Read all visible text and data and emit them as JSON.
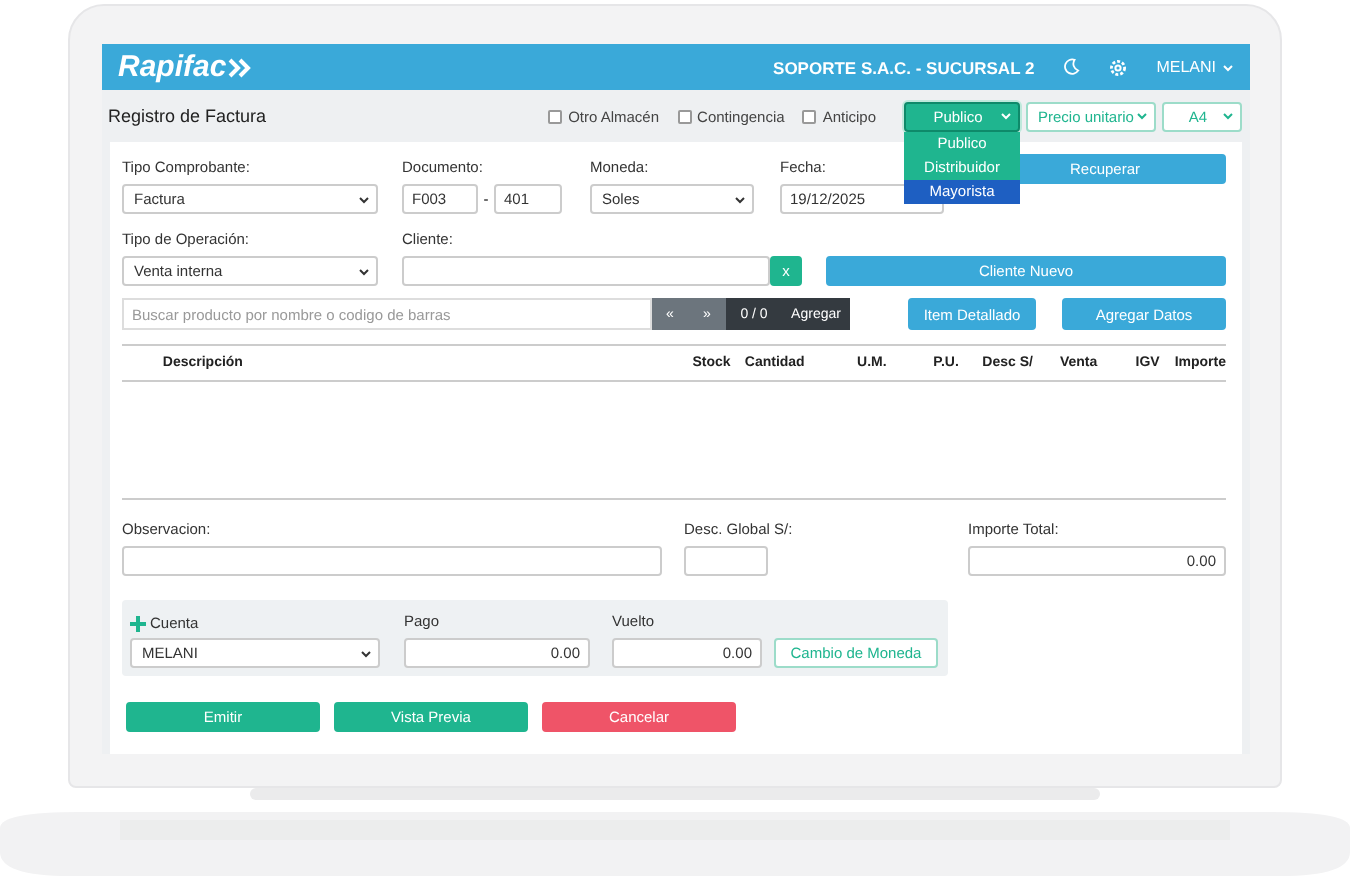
{
  "app": {
    "logo": "Rapifac",
    "company": "SOPORTE S.A.C. - SUCURSAL 2",
    "user": "MELANI"
  },
  "page_title": "Registro de Factura",
  "options": [
    {
      "label": "Otro Almacén",
      "checked": false
    },
    {
      "label": "Contingencia",
      "checked": false
    },
    {
      "label": "Anticipo",
      "checked": false
    }
  ],
  "price_list": {
    "value": "Publico",
    "expanded": true,
    "options": [
      {
        "label": "Publico",
        "highlighted": false
      },
      {
        "label": "Distribuidor",
        "highlighted": false
      },
      {
        "label": "Mayorista",
        "highlighted": true
      }
    ]
  },
  "price_type": "Precio unitario",
  "format": "A4",
  "tipo_comprobante": {
    "label": "Tipo Comprobante:",
    "value": "Factura"
  },
  "documento": {
    "label": "Documento:",
    "serie": "F003",
    "separator": "-",
    "numero": "401"
  },
  "moneda": {
    "label": "Moneda:",
    "value": "Soles"
  },
  "fecha": {
    "label": "Fecha:",
    "value": "19/12/2025"
  },
  "recuperar": "Recuperar",
  "tipo_operacion": {
    "label": "Tipo de Operación:",
    "value": "Venta interna"
  },
  "cliente": {
    "label": "Cliente:",
    "clear": "x"
  },
  "cliente_nuevo": "Cliente Nuevo",
  "search": {
    "placeholder": "Buscar producto por nombre o codigo de barras",
    "prev": "«",
    "next": "»",
    "counter": "0 / 0",
    "add": "Agregar"
  },
  "item_detallado": "Item Detallado",
  "agregar_datos": "Agregar Datos",
  "table": {
    "columns": [
      "Descripción",
      "Stock",
      "Cantidad",
      "U.M.",
      "P.U.",
      "Desc S/",
      "Venta",
      "IGV",
      "Importe"
    ]
  },
  "observacion": {
    "label": "Observacion:"
  },
  "desc_global": {
    "label": "Desc. Global S/:"
  },
  "importe_total": {
    "label": "Importe Total:",
    "value": "0.00"
  },
  "payment": {
    "cuenta_label": "Cuenta",
    "cuenta": "MELANI",
    "pago_label": "Pago",
    "pago": "0.00",
    "vuelto_label": "Vuelto",
    "vuelto": "0.00",
    "cambio": "Cambio de Moneda"
  },
  "actions": [
    {
      "label": "Emitir",
      "kind": "primary"
    },
    {
      "label": "Vista Previa",
      "kind": "primary"
    },
    {
      "label": "Cancelar",
      "kind": "danger"
    }
  ]
}
